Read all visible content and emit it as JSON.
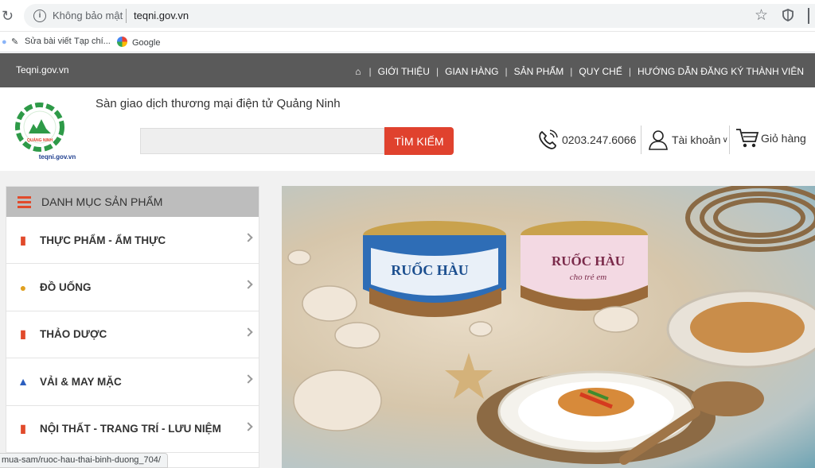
{
  "browser": {
    "insecure_label": "Không bảo mật",
    "url": "teqni.gov.vn",
    "bookmarks": [
      {
        "label": "Sửa bài viết"
      },
      {
        "label": "Tạp chí..."
      },
      {
        "label": "Google"
      }
    ],
    "status_url": "mua-sam/ruoc-hau-thai-binh-duong_704/"
  },
  "topbar": {
    "site_name": "Teqni.gov.vn",
    "nav": [
      "GIỚI THIỆU",
      "GIAN HÀNG",
      "SẢN PHẨM",
      "QUY CHẾ",
      "HƯỚNG DẪN ĐĂNG KÝ THÀNH VIÊN"
    ]
  },
  "header": {
    "tagline": "Sàn giao dịch thương mại điện tử Quảng Ninh",
    "logo_text": "teqni.gov.vn",
    "logo_ring_text": "SÀN THƯƠNG MẠI ĐIỆN TỬ QUẢNG NINH",
    "search_value": "",
    "search_button": "TÌM KIẾM",
    "phone": "0203.247.6066",
    "account": "Tài khoản",
    "cart": "Giỏ hàng"
  },
  "sidebar": {
    "title": "DANH MỤC SẢN PHẨM",
    "items": [
      {
        "label": "THỰC PHẨM - ẨM THỰC",
        "icon": "bottle-icon"
      },
      {
        "label": "ĐỒ UỐNG",
        "icon": "dish-icon"
      },
      {
        "label": "THẢO DƯỢC",
        "icon": "bottle-icon"
      },
      {
        "label": "VẢI & MAY MẶC",
        "icon": "dress-icon"
      },
      {
        "label": "NỘI THẤT - TRANG TRÍ - LƯU NIỆM",
        "icon": "bottle-icon"
      }
    ]
  },
  "banner": {
    "jar1_label": "RUỐC HÀU",
    "jar2_label": "RUỐC HÀU",
    "jar2_sub": "cho trẻ em"
  },
  "colors": {
    "topbar_bg": "#5a5a5a",
    "accent_red": "#e0422e",
    "sidebar_head_bg": "#bdbdbd"
  }
}
